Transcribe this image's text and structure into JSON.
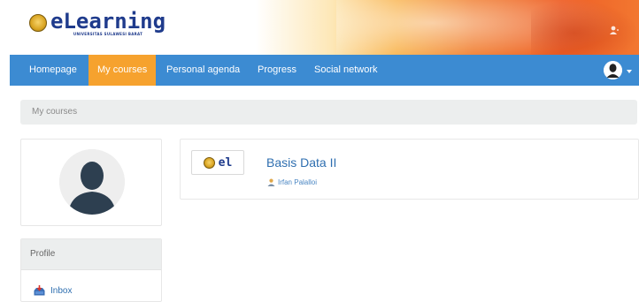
{
  "brand": {
    "logo_text": "eLearning",
    "logo_subtitle": "UNIVERSITAS SULAWESI BARAT"
  },
  "nav": {
    "items": [
      {
        "label": "Homepage",
        "active": false
      },
      {
        "label": "My courses",
        "active": true
      },
      {
        "label": "Personal agenda",
        "active": false
      },
      {
        "label": "Progress",
        "active": false
      },
      {
        "label": "Social network",
        "active": false
      }
    ]
  },
  "breadcrumb": {
    "current": "My courses"
  },
  "sidebar": {
    "profile_title": "Profile",
    "links": [
      {
        "label": "Inbox",
        "icon": "inbox-icon"
      }
    ]
  },
  "courses": [
    {
      "thumb_text": "el",
      "title": "Basis Data II",
      "teacher": "Irfan Palalloi"
    }
  ],
  "colors": {
    "navbar": "#3c8bd2",
    "active_tab": "#f6a22e",
    "link": "#2f6fb0"
  }
}
